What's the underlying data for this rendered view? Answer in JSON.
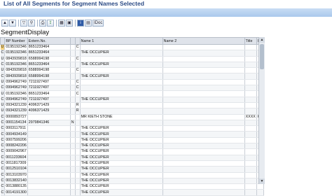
{
  "window": {
    "title": "List of All Segments for Segment Names Selected"
  },
  "toolbar": {
    "buttons": [
      {
        "name": "sort-ascending",
        "label": "▲"
      },
      {
        "name": "sort-descending",
        "label": "▼"
      },
      {
        "name": "filter",
        "label": "▽"
      },
      {
        "name": "find",
        "label": "⚲"
      },
      {
        "name": "print",
        "label": "⎙"
      },
      {
        "name": "export",
        "label": "⇪"
      },
      {
        "name": "layout",
        "label": "▦"
      },
      {
        "name": "select-layout",
        "label": "▣"
      },
      {
        "name": "info",
        "label": "i"
      },
      {
        "name": "details",
        "label": "▤"
      },
      {
        "name": "idoc",
        "label": "IDoc"
      }
    ]
  },
  "display": {
    "title": "SegmentDisplay"
  },
  "table": {
    "columns": [
      "",
      "BP Number",
      "Extern.No.",
      "",
      "",
      "Name 1",
      "Name 2",
      "Title",
      "Init"
    ],
    "rows": [
      [
        "U",
        "0195192346",
        "8651233464",
        "",
        "C",
        "",
        "",
        "",
        ""
      ],
      [
        "C",
        "0195192346",
        "8651233464",
        "",
        "",
        "THE OCCUPIER",
        "",
        "",
        ""
      ],
      [
        "U",
        "0843939818",
        "6588994198",
        "",
        "C",
        "",
        "",
        "",
        ""
      ],
      [
        "C",
        "0195192346",
        "8651233464",
        "",
        "",
        "THE OCCUPIER",
        "",
        "",
        ""
      ],
      [
        "U",
        "0843939818",
        "6588994198",
        "",
        "C",
        "",
        "",
        "",
        ""
      ],
      [
        "C",
        "0843939818",
        "6588994198",
        "",
        "",
        "THE OCCUPIER",
        "",
        "",
        ""
      ],
      [
        "U",
        "0994962749",
        "7211927497",
        "",
        "C",
        "",
        "",
        "",
        ""
      ],
      [
        "C",
        "0994962749",
        "7211927497",
        "",
        "C",
        "",
        "",
        "",
        ""
      ],
      [
        "U",
        "0195192346",
        "8651233464",
        "",
        "C",
        "",
        "",
        "",
        ""
      ],
      [
        "C",
        "0994962749",
        "7211927497",
        "",
        "",
        "THE OCCUPIER",
        "",
        "",
        ""
      ],
      [
        "U",
        "0934321239",
        "4096371429",
        "",
        "R",
        "",
        "",
        "",
        ""
      ],
      [
        "U",
        "0934321239",
        "4096371429",
        "",
        "R",
        "",
        "",
        "",
        ""
      ],
      [
        "C",
        "0000893727",
        "",
        "",
        "",
        "MR KIETH STONE",
        "",
        "XXXX",
        "K"
      ],
      [
        "C",
        "0001154134",
        "2979841346",
        "N",
        "",
        "",
        "",
        "",
        ""
      ],
      [
        "C",
        "0003117911",
        "",
        "",
        "",
        "THE OCCUPIER",
        "",
        "",
        ""
      ],
      [
        "C",
        "0004934149",
        "",
        "",
        "",
        "THE OCCUPIER",
        "",
        "",
        ""
      ],
      [
        "C",
        "0007599206",
        "",
        "",
        "",
        "THE OCCUPIER",
        "",
        "",
        ""
      ],
      [
        "C",
        "0008242206",
        "",
        "",
        "",
        "THE OCCUPIER",
        "",
        "",
        ""
      ],
      [
        "C",
        "0009042967",
        "",
        "",
        "",
        "THE OCCUPIER",
        "",
        "",
        ""
      ],
      [
        "C",
        "0011233604",
        "",
        "",
        "",
        "THE OCCUPIER",
        "",
        "",
        ""
      ],
      [
        "C",
        "0011817309",
        "",
        "",
        "",
        "THE OCCUPIER",
        "",
        "",
        ""
      ],
      [
        "C",
        "0012510104",
        "",
        "",
        "",
        "THE OCCUPIER",
        "",
        "",
        ""
      ],
      [
        "C",
        "0013103970",
        "",
        "",
        "",
        "THE OCCUPIER",
        "",
        "",
        ""
      ],
      [
        "C",
        "0013832140",
        "",
        "",
        "",
        "THE OCCUPIER",
        "",
        "",
        ""
      ],
      [
        "C",
        "0013880135",
        "",
        "",
        "",
        "THE OCCUPIER",
        "",
        "",
        ""
      ],
      [
        "C",
        "0014191300",
        "",
        "",
        "",
        "THE OCCUPIER",
        "",
        "",
        ""
      ]
    ]
  }
}
